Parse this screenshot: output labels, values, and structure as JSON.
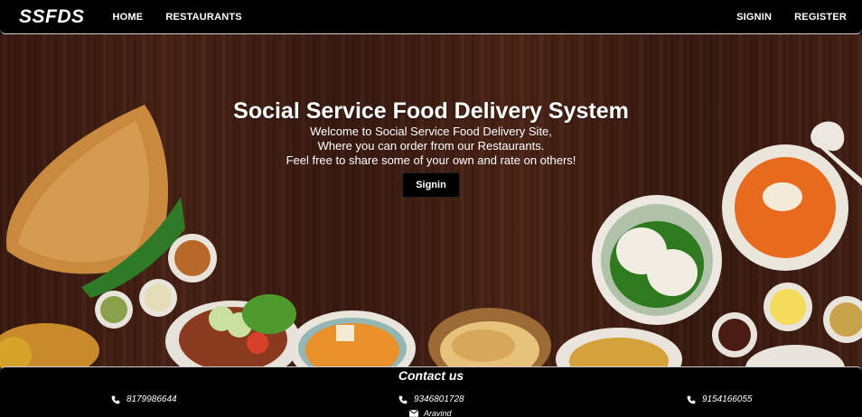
{
  "navbar": {
    "brand": "SSFDS",
    "left_links": [
      "HOME",
      "RESTAURANTS"
    ],
    "right_links": [
      "SIGNIN",
      "REGISTER"
    ]
  },
  "hero": {
    "title": "Social Service Food Delivery System",
    "lines": [
      "Welcome to Social Service Food Delivery Site,",
      "Where you can order from our Restaurants.",
      "Feel free to share some of your own and rate on others!"
    ],
    "button_label": "Signin",
    "background_color": "#3f1d12"
  },
  "footer": {
    "title": "Contact us",
    "phones": [
      "8179986644",
      "9346801728",
      "9154166055"
    ],
    "name": "Aravind",
    "phone_icon": "phone-icon",
    "mail_icon": "envelope-icon"
  },
  "colors": {
    "navbar_bg": "#000000",
    "footer_bg": "#000000",
    "text": "#ffffff"
  }
}
